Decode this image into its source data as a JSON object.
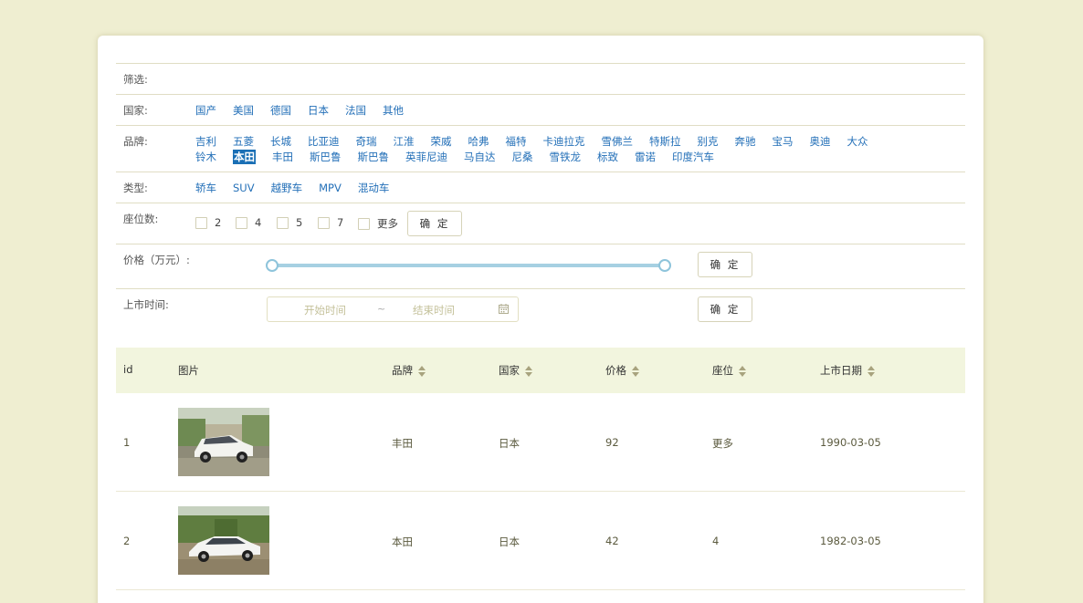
{
  "filters": {
    "filter_label": "筛选:",
    "country": {
      "label": "国家:",
      "options": [
        "国产",
        "美国",
        "德国",
        "日本",
        "法国",
        "其他"
      ]
    },
    "brand": {
      "label": "品牌:",
      "row1": [
        "吉利",
        "五菱",
        "长城",
        "比亚迪",
        "奇瑞",
        "江淮",
        "荣威",
        "哈弗",
        "福特",
        "卡迪拉克",
        "雪佛兰",
        "特斯拉",
        "别克",
        "奔驰",
        "宝马",
        "奥迪",
        "大众"
      ],
      "row2": [
        "铃木",
        "本田",
        "丰田",
        "斯巴鲁",
        "斯巴鲁",
        "英菲尼迪",
        "马自达",
        "尼桑",
        "雪铁龙",
        "标致",
        "雷诺",
        "印度汽车"
      ],
      "selected": "本田"
    },
    "type": {
      "label": "类型:",
      "options": [
        "轿车",
        "SUV",
        "越野车",
        "MPV",
        "混动车"
      ]
    },
    "seats": {
      "label": "座位数:",
      "options": [
        "2",
        "4",
        "5",
        "7",
        "更多"
      ],
      "confirm": "确 定"
    },
    "price": {
      "label": "价格（万元）:",
      "range_min_fraction": 0.0,
      "range_max_fraction": 1.0,
      "confirm": "确 定"
    },
    "date": {
      "label": "上市时间:",
      "start_placeholder": "开始时间",
      "separator": "~",
      "end_placeholder": "结束时间",
      "confirm": "确 定"
    }
  },
  "table": {
    "columns": {
      "id": "id",
      "image": "图片",
      "brand": "品牌",
      "country": "国家",
      "price": "价格",
      "seats": "座位",
      "date": "上市日期"
    },
    "rows": [
      {
        "id": "1",
        "brand": "丰田",
        "country": "日本",
        "price": "92",
        "seats": "更多",
        "date": "1990-03-05",
        "image": "white-suv-photo"
      },
      {
        "id": "2",
        "brand": "本田",
        "country": "日本",
        "price": "42",
        "seats": "4",
        "date": "1982-03-05",
        "image": "white-sedan-photo"
      }
    ]
  },
  "colors": {
    "background": "#efeed1",
    "link": "#2470b8",
    "selected": "#1a6fb5",
    "table_header": "#f2f5de",
    "slider": "#a6d0e2"
  }
}
